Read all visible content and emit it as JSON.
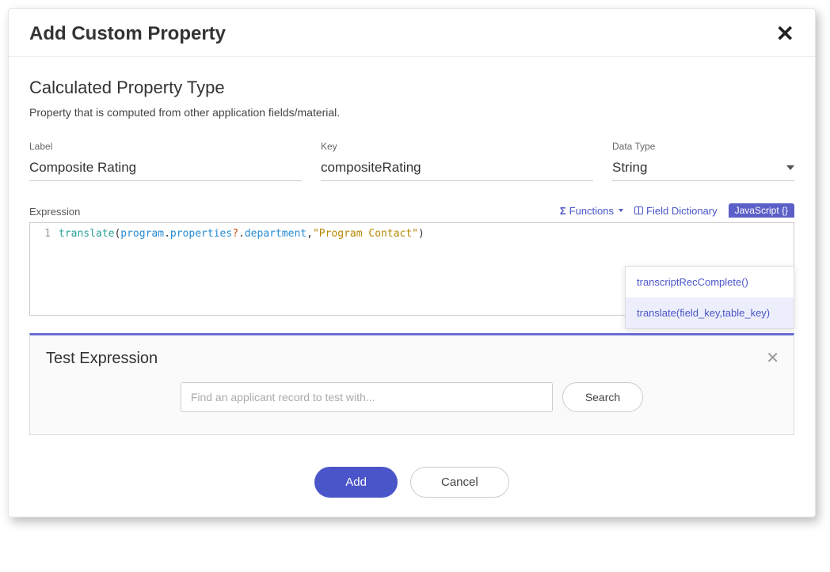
{
  "modal": {
    "title": "Add Custom Property",
    "section_title": "Calculated Property Type",
    "section_desc": "Property that is computed from other application fields/material."
  },
  "fields": {
    "label_caption": "Label",
    "label_value": "Composite Rating",
    "key_caption": "Key",
    "key_value": "compositeRating",
    "datatype_caption": "Data Type",
    "datatype_value": "String"
  },
  "expression": {
    "caption": "Expression",
    "functions_label": "Functions",
    "field_dict_label": "Field Dictionary",
    "js_badge": "JavaScript {}",
    "code": {
      "line_no": "1",
      "func": "translate",
      "chain1": "program",
      "chain2": "properties",
      "opt": "?",
      "chain3": "department",
      "str": "\"Program Contact\""
    }
  },
  "dropdown": {
    "item1": "transcriptRecComplete()",
    "item2": "translate(field_key,table_key)"
  },
  "test": {
    "title": "Test Expression",
    "placeholder": "Find an applicant record to test with...",
    "search": "Search"
  },
  "footer": {
    "add": "Add",
    "cancel": "Cancel"
  }
}
